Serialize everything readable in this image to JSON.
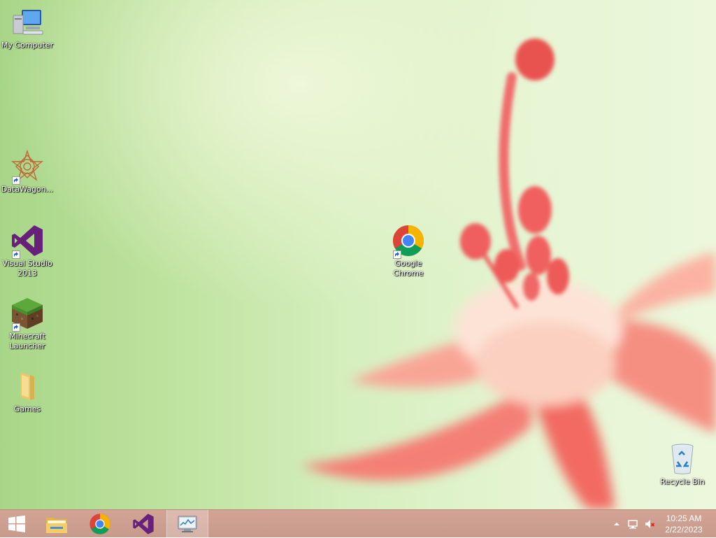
{
  "desktop": {
    "icons": [
      {
        "label": "My Computer",
        "icon": "my-computer-icon"
      },
      {
        "label": "DataWagon...",
        "icon": "datawagon-icon"
      },
      {
        "label": "Visual Studio 2013",
        "icon": "visual-studio-icon"
      },
      {
        "label": "Minecraft Launcher",
        "icon": "minecraft-icon"
      },
      {
        "label": "Games",
        "icon": "folder-icon"
      },
      {
        "label": "Google Chrome",
        "icon": "chrome-icon"
      },
      {
        "label": "Recycle Bin",
        "icon": "recycle-bin-icon"
      }
    ]
  },
  "taskbar": {
    "items": [
      {
        "name": "start-button",
        "icon": "windows-logo-icon"
      },
      {
        "name": "file-explorer",
        "icon": "file-explorer-icon"
      },
      {
        "name": "google-chrome",
        "icon": "chrome-icon"
      },
      {
        "name": "visual-studio",
        "icon": "visual-studio-icon"
      },
      {
        "name": "performance-monitor",
        "icon": "performance-monitor-icon",
        "active": true
      }
    ],
    "tray": {
      "icons": [
        "show-hidden-icons-arrow",
        "network-icon",
        "volume-muted-icon"
      ],
      "time": "10:25 AM",
      "date": "2/22/2023"
    }
  },
  "colors": {
    "taskbar": "#c99c8e",
    "wallpaper_green": "#c9e8ad",
    "flower_pink": "#f57a74"
  }
}
